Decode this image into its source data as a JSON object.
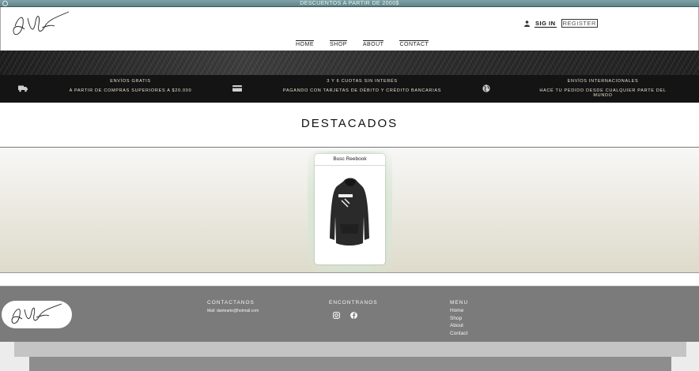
{
  "promo": {
    "text": "DESCUENTOS A PARTIR DE 2000$"
  },
  "header": {
    "signin_label": "SIG IN",
    "register_label": "REGISTER",
    "nav": [
      "HOME",
      "SHOP",
      "ABOUT",
      "CONTACT"
    ]
  },
  "features": [
    {
      "icon": "truck-icon",
      "title": "ENVÍOS GRATIS",
      "subtitle": "A PARTIR DE COMPRAS SUPERIORES A $20.000"
    },
    {
      "icon": "credit-card-icon",
      "title": "3 Y 6 CUOTAS SIN INTERÉS",
      "subtitle": "PAGANDO CON TARJETAS DE DÉBITO Y CRÉDITO BANCARIAS"
    },
    {
      "icon": "globe-icon",
      "title": "ENVÍOS INTERNACIONALES",
      "subtitle": "HACÉ TU PEDIDO DESDE CUALQUIER PARTE DEL MUNDO"
    }
  ],
  "featured": {
    "title": "DESTACADOS",
    "products": [
      {
        "name": "Busc Reebook"
      }
    ]
  },
  "footer": {
    "contact_title": "CONTACTANOS",
    "contact_mail": "Mail: dantearte@hotmail.com",
    "find_title": "ENCONTRANOS",
    "social": [
      "instagram-icon",
      "facebook-icon"
    ],
    "menu_title": "MENU",
    "menu_links": [
      "Home",
      "Shop",
      "About",
      "Contact"
    ]
  },
  "colors": {
    "promo": "#6f9498",
    "features_bg": "#141414",
    "footer_bg": "#7b7b7b",
    "features_text": "#e9e2cf"
  }
}
